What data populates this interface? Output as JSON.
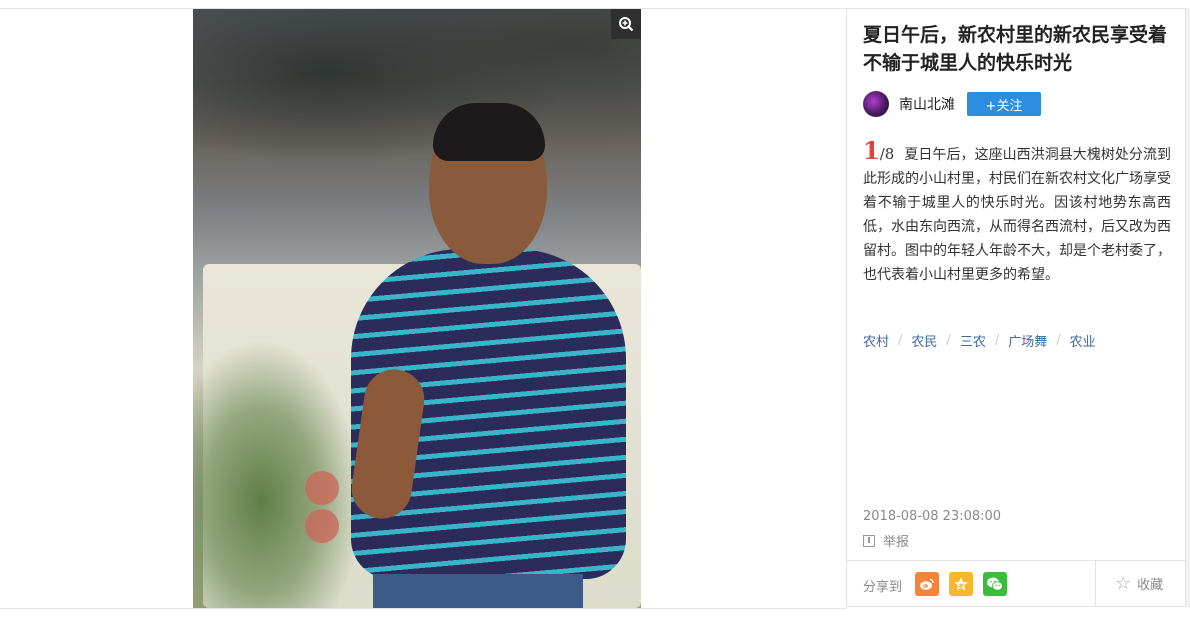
{
  "article": {
    "title": "夏日午后，新农村里的新农民享受着不输于城里人的快乐时光"
  },
  "author": {
    "name": "南山北滩",
    "follow_label": "+关注"
  },
  "pagination": {
    "current": "1",
    "total": "/8"
  },
  "description": "夏日午后，这座山西洪洞县大槐树处分流到此形成的小山村里，村民们在新农村文化广场享受着不输于城里人的快乐时光。因该村地势东高西低，水由东向西流，从而得名西流村，后又改为西留村。图中的年轻人年龄不大，却是个老村委了，也代表着小山村里更多的希望。",
  "tags": [
    "农村",
    "农民",
    "三农",
    "广场舞",
    "农业"
  ],
  "tag_separator": "/",
  "publish_time": "2018-08-08 23:08:00",
  "report_label": "举报",
  "share": {
    "label": "分享到",
    "services": [
      {
        "icon": "weibo-icon",
        "color": "#f5833a"
      },
      {
        "icon": "qzone-star-icon",
        "color": "#f7b62c"
      },
      {
        "icon": "wechat-icon",
        "color": "#3bbd3b"
      }
    ]
  },
  "favorite_label": "收藏",
  "icons": {
    "zoom": "zoom-in-icon",
    "favorite": "star-outline-icon",
    "report": "report-icon"
  },
  "colors": {
    "follow_button": "#2d8de0",
    "page_current": "#e0413a",
    "tag_link": "#3d6a9c"
  }
}
